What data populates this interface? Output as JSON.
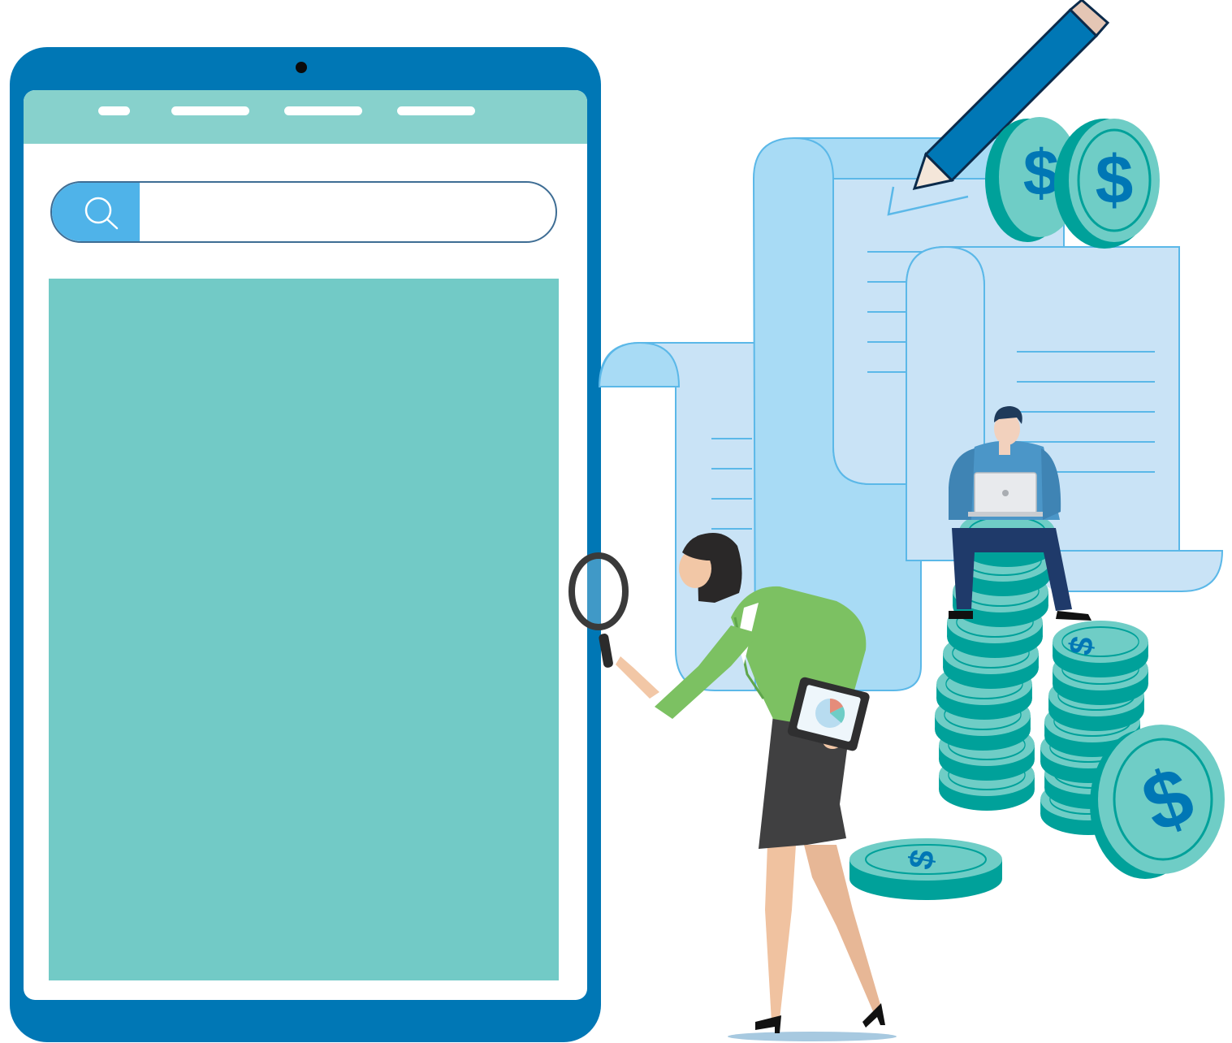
{
  "navbar": {
    "items": [
      "",
      "",
      "",
      ""
    ]
  },
  "search": {
    "value": "",
    "placeholder": "",
    "icon": "search-icon"
  },
  "illustration": {
    "coin_symbol": "$",
    "icons": [
      "pencil-icon",
      "receipt-scroll-icon",
      "coin-stack-icon",
      "magnifying-glass-icon",
      "laptop-icon",
      "tablet-chart-icon"
    ]
  },
  "colors": {
    "tablet_frame": "#0077b5",
    "navbar": "#87d1cc",
    "search_button": "#4fb3e9",
    "content": "#72cac6",
    "coin_face": "#6fcdc6",
    "coin_edge": "#00a19a",
    "coin_symbol": "#0077b5",
    "paper": "#c9e3f6",
    "paper_outline": "#5bb8e8",
    "jacket_green": "#7cc162",
    "man_shirt": "#4b96c8"
  }
}
